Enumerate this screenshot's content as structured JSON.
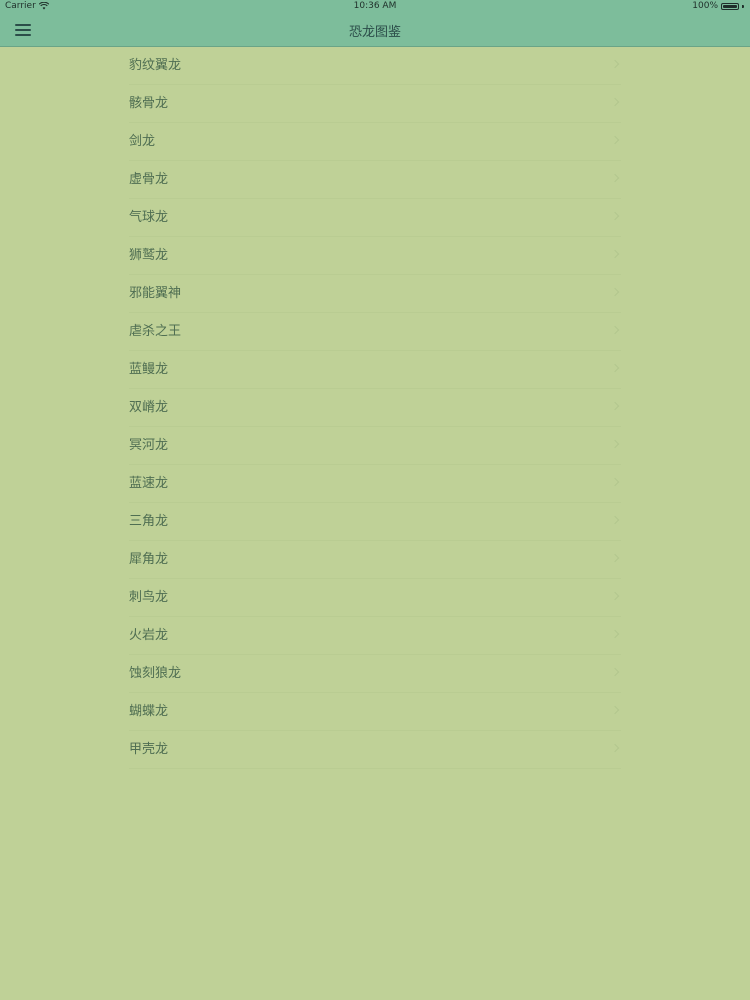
{
  "status_bar": {
    "carrier": "Carrier",
    "time": "10:36 AM",
    "battery": "100%",
    "wifi_icon": "wifi-icon",
    "battery_icon": "battery-icon"
  },
  "nav": {
    "title": "恐龙图鉴",
    "menu_icon": "hamburger-menu-icon"
  },
  "list": {
    "items": [
      "豹纹翼龙",
      "骸骨龙",
      "剑龙",
      "虚骨龙",
      "气球龙",
      "狮鹫龙",
      "邪能翼神",
      "虐杀之王",
      "蓝鳗龙",
      "双嵴龙",
      "冥河龙",
      "蓝速龙",
      "三角龙",
      "犀角龙",
      "刺鸟龙",
      "火岩龙",
      "蚀刻狼龙",
      "蝴蝶龙",
      "甲壳龙"
    ]
  },
  "colors": {
    "nav_background": "#7dbd9b",
    "page_background": "#bfd197",
    "item_text": "#4f6e52"
  }
}
